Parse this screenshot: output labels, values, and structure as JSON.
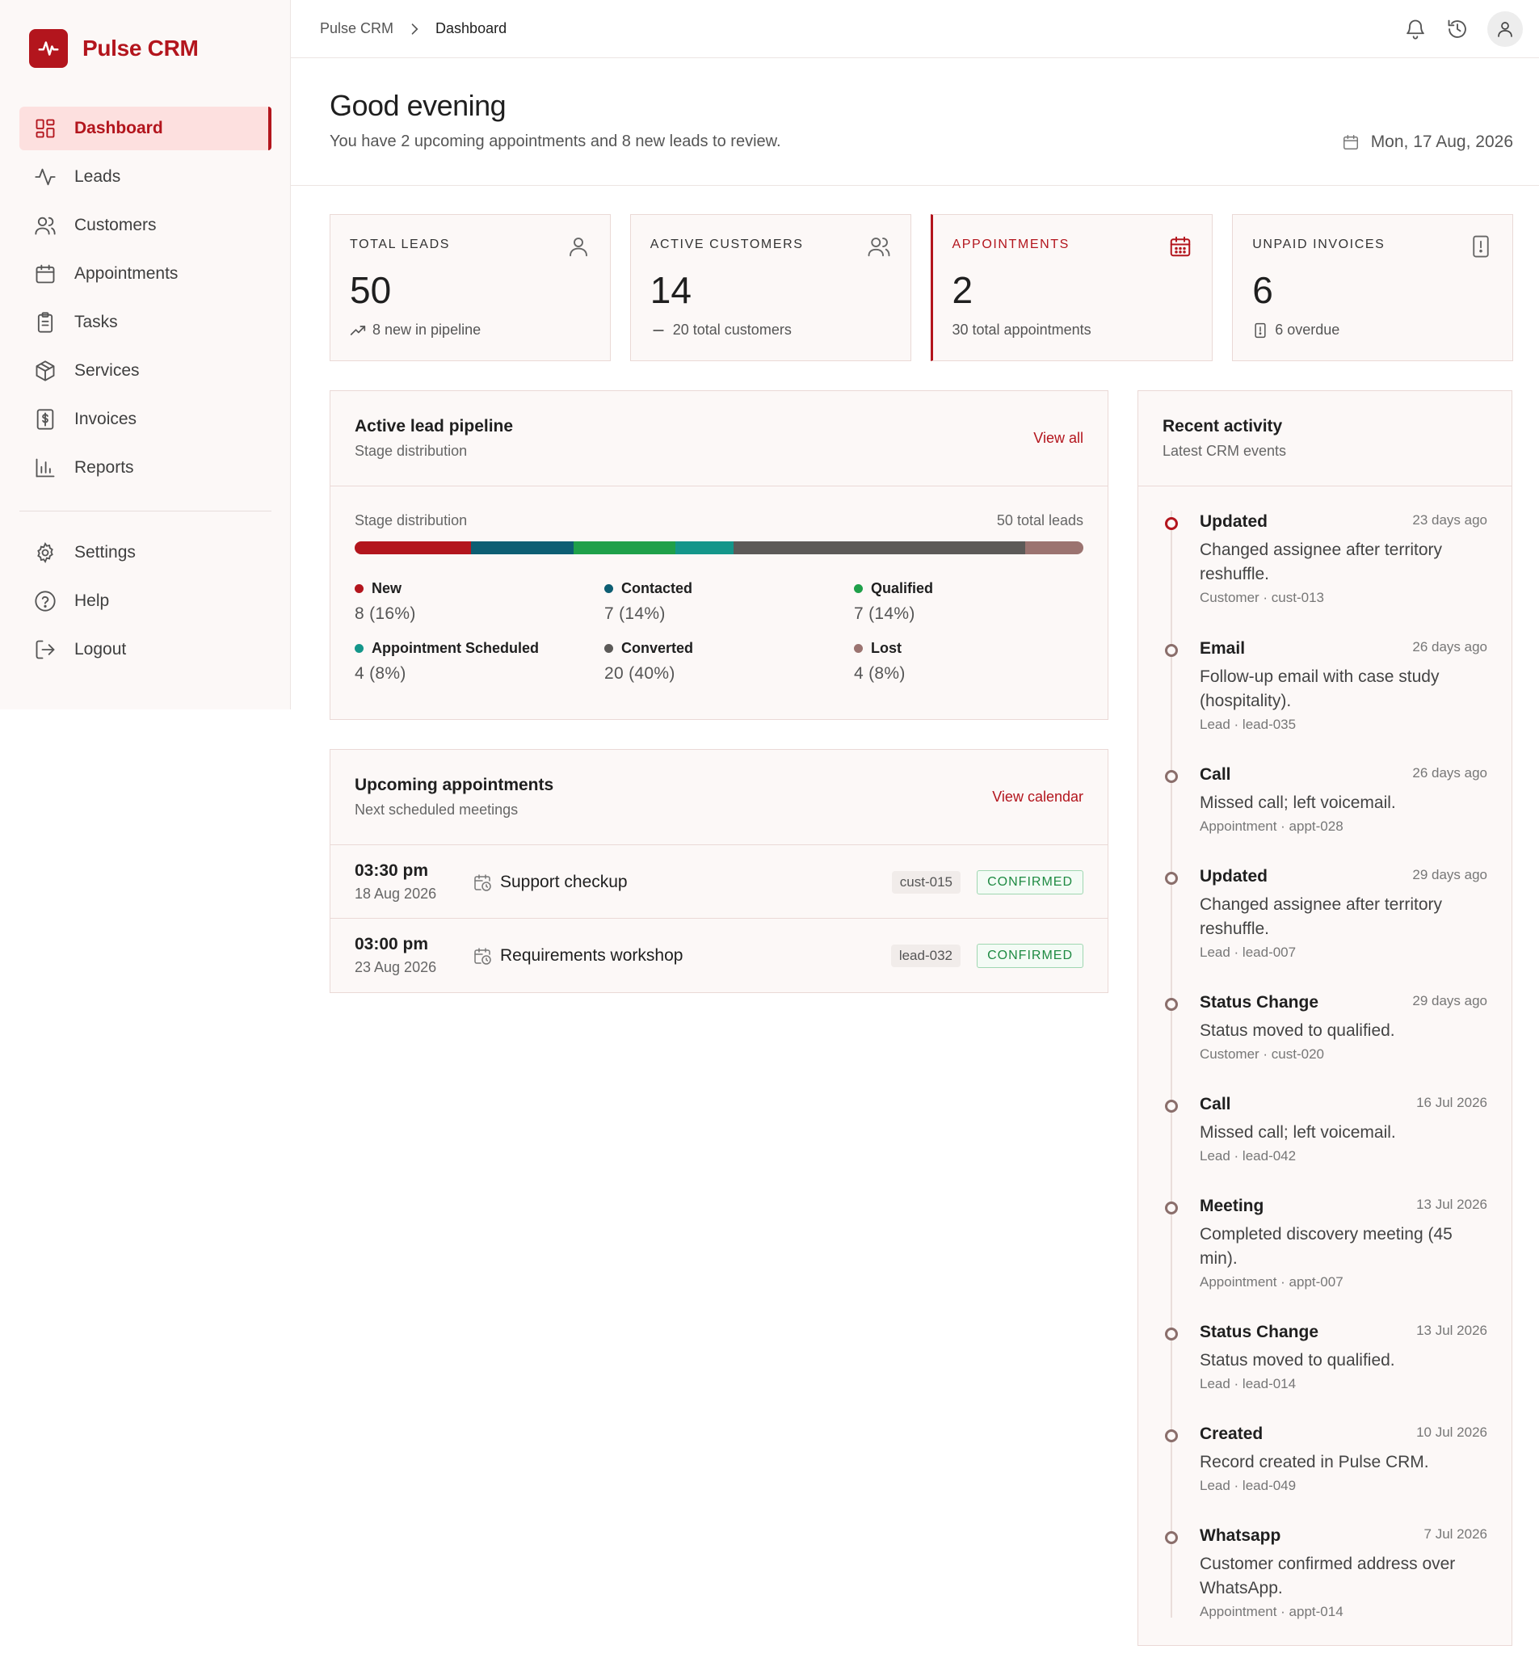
{
  "brand": {
    "name": "Pulse CRM",
    "color": "#b3151d"
  },
  "nav": {
    "items": [
      {
        "label": "Dashboard",
        "icon": "dashboard-icon",
        "active": true
      },
      {
        "label": "Leads",
        "icon": "activity-icon"
      },
      {
        "label": "Customers",
        "icon": "users-icon"
      },
      {
        "label": "Appointments",
        "icon": "calendar-icon"
      },
      {
        "label": "Tasks",
        "icon": "clipboard-icon"
      },
      {
        "label": "Services",
        "icon": "box-icon"
      },
      {
        "label": "Invoices",
        "icon": "invoice-icon"
      },
      {
        "label": "Reports",
        "icon": "bar-chart-icon"
      }
    ],
    "secondary": [
      {
        "label": "Settings",
        "icon": "gear-icon"
      },
      {
        "label": "Help",
        "icon": "help-icon"
      },
      {
        "label": "Logout",
        "icon": "logout-icon"
      }
    ]
  },
  "breadcrumb": {
    "root": "Pulse CRM",
    "current": "Dashboard"
  },
  "greeting": {
    "title": "Good evening",
    "subtitle": "You have 2 upcoming appointments and 8 new leads to review.",
    "date": "Mon, 17 Aug, 2026"
  },
  "stats": {
    "total_leads": {
      "label": "TOTAL LEADS",
      "value": "50",
      "foot": "8 new in pipeline"
    },
    "active_customers": {
      "label": "ACTIVE CUSTOMERS",
      "value": "14",
      "foot": "20 total customers"
    },
    "appointments": {
      "label": "APPOINTMENTS",
      "value": "2",
      "foot": "30 total appointments"
    },
    "unpaid_invoices": {
      "label": "UNPAID INVOICES",
      "value": "6",
      "foot": "6 overdue"
    }
  },
  "pipeline": {
    "title": "Active lead pipeline",
    "subtitle": "Stage distribution",
    "link": "View all",
    "row_label": "Stage distribution",
    "total": "50 total leads",
    "stages": [
      {
        "name": "New",
        "display": "8 (16%)",
        "count": 8,
        "color": "#b3151d"
      },
      {
        "name": "Contacted",
        "display": "7 (14%)",
        "count": 7,
        "color": "#0d5e73"
      },
      {
        "name": "Qualified",
        "display": "7 (14%)",
        "count": 7,
        "color": "#1fa04a"
      },
      {
        "name": "Appointment Scheduled",
        "display": "4 (8%)",
        "count": 4,
        "color": "#14968a"
      },
      {
        "name": "Converted",
        "display": "20 (40%)",
        "count": 20,
        "color": "#5c5a58"
      },
      {
        "name": "Lost",
        "display": "4 (8%)",
        "count": 4,
        "color": "#9b7370"
      }
    ]
  },
  "appointments": {
    "title": "Upcoming appointments",
    "subtitle": "Next scheduled meetings",
    "link": "View calendar",
    "items": [
      {
        "time": "03:30 pm",
        "date": "18 Aug 2026",
        "title": "Support checkup",
        "ref": "cust-015",
        "status": "CONFIRMED"
      },
      {
        "time": "03:00 pm",
        "date": "23 Aug 2026",
        "title": "Requirements workshop",
        "ref": "lead-032",
        "status": "CONFIRMED"
      }
    ]
  },
  "activity": {
    "title": "Recent activity",
    "subtitle": "Latest CRM events",
    "items": [
      {
        "type": "Updated",
        "time": "23 days ago",
        "desc": "Changed assignee after territory reshuffle.",
        "meta": "Customer · cust-013"
      },
      {
        "type": "Email",
        "time": "26 days ago",
        "desc": "Follow-up email with case study (hospitality).",
        "meta": "Lead · lead-035"
      },
      {
        "type": "Call",
        "time": "26 days ago",
        "desc": "Missed call; left voicemail.",
        "meta": "Appointment · appt-028"
      },
      {
        "type": "Updated",
        "time": "29 days ago",
        "desc": "Changed assignee after territory reshuffle.",
        "meta": "Lead · lead-007"
      },
      {
        "type": "Status Change",
        "time": "29 days ago",
        "desc": "Status moved to qualified.",
        "meta": "Customer · cust-020"
      },
      {
        "type": "Call",
        "time": "16 Jul 2026",
        "desc": "Missed call; left voicemail.",
        "meta": "Lead · lead-042"
      },
      {
        "type": "Meeting",
        "time": "13 Jul 2026",
        "desc": "Completed discovery meeting (45 min).",
        "meta": "Appointment · appt-007"
      },
      {
        "type": "Status Change",
        "time": "13 Jul 2026",
        "desc": "Status moved to qualified.",
        "meta": "Lead · lead-014"
      },
      {
        "type": "Created",
        "time": "10 Jul 2026",
        "desc": "Record created in Pulse CRM.",
        "meta": "Lead · lead-049"
      },
      {
        "type": "Whatsapp",
        "time": "7 Jul 2026",
        "desc": "Customer confirmed address over WhatsApp.",
        "meta": "Appointment · appt-014"
      }
    ]
  }
}
